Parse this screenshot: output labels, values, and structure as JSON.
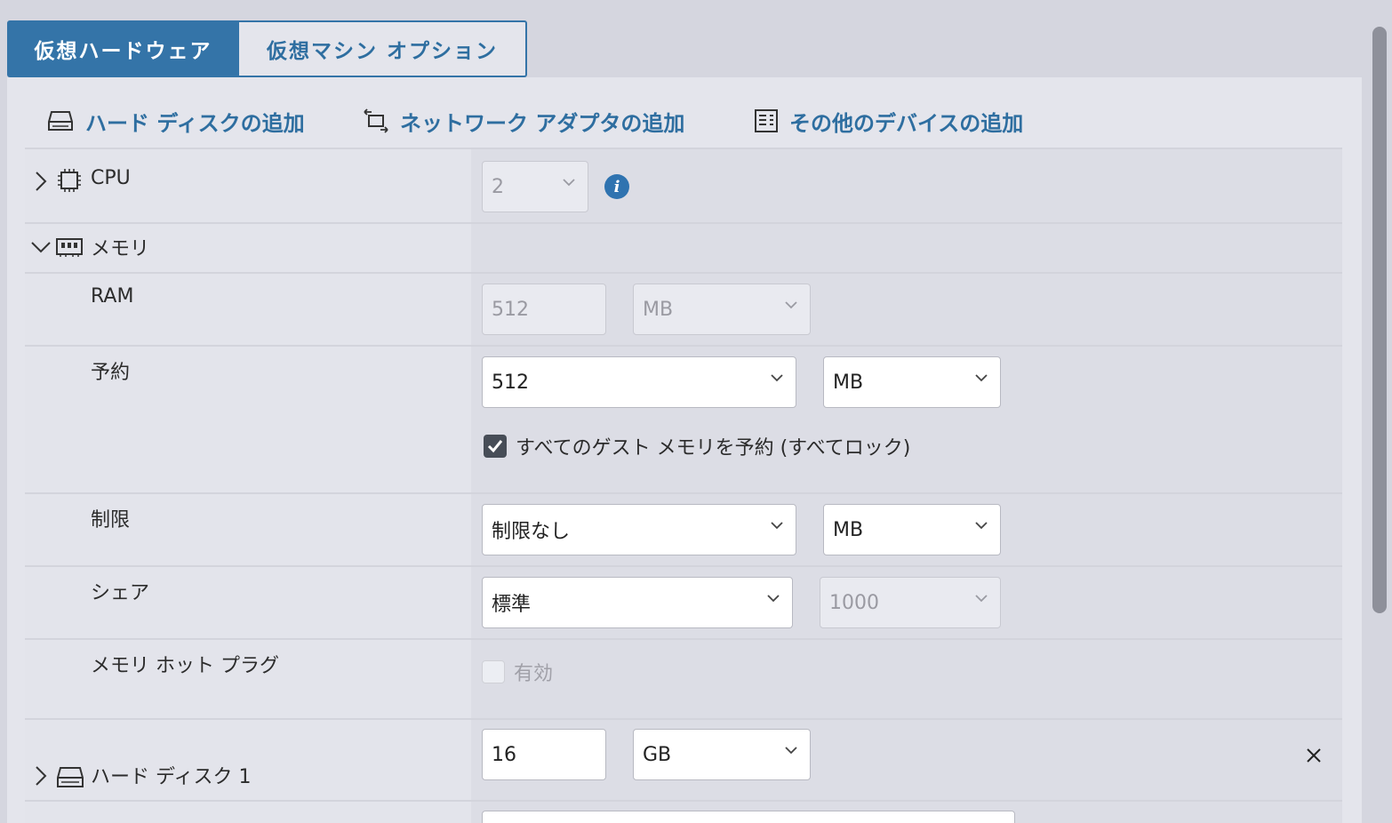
{
  "tabs": {
    "hardware": "仮想ハードウェア",
    "options": "仮想マシン オプション"
  },
  "actions": {
    "add_disk": "ハード ディスクの追加",
    "add_network": "ネットワーク アダプタの追加",
    "add_other": "その他のデバイスの追加"
  },
  "cpu": {
    "label": "CPU",
    "value": "2"
  },
  "memory": {
    "label": "メモリ",
    "ram": {
      "label": "RAM",
      "value": "512",
      "unit": "MB"
    },
    "reservation": {
      "label": "予約",
      "value": "512",
      "unit": "MB",
      "reserve_all_label": "すべてのゲスト メモリを予約 (すべてロック)",
      "reserve_all_checked": true
    },
    "limit": {
      "label": "制限",
      "value": "制限なし",
      "unit": "MB"
    },
    "shares": {
      "label": "シェア",
      "value": "標準",
      "amount": "1000"
    },
    "hotplug": {
      "label": "メモリ ホット プラグ",
      "enable_label": "有効",
      "checked": false
    }
  },
  "disk1": {
    "label": "ハード ディスク 1",
    "size": "16",
    "unit": "GB"
  },
  "colors": {
    "accent": "#3474a8",
    "link": "#2e6ea0",
    "background": "#d5d6df"
  }
}
